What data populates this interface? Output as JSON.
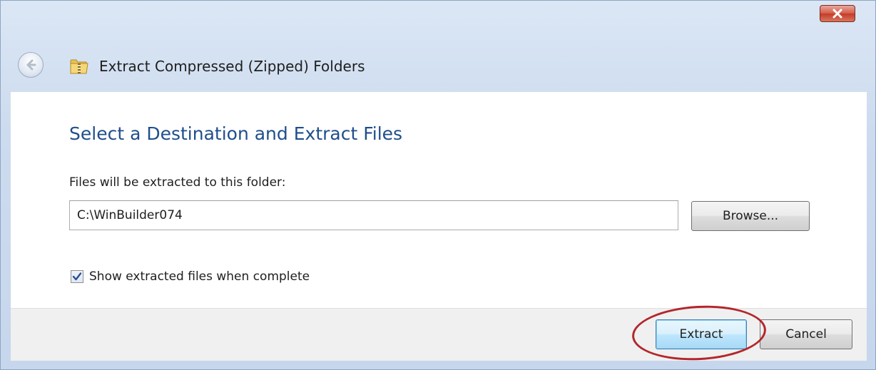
{
  "window": {
    "title": "Extract Compressed (Zipped) Folders",
    "close_icon": "close-icon",
    "back_icon": "back-arrow-icon",
    "app_icon": "zip-folder-icon"
  },
  "page": {
    "heading": "Select a Destination and Extract Files",
    "folder_label": "Files will be extracted to this folder:",
    "folder_path": "C:\\WinBuilder074",
    "browse_label": "Browse...",
    "show_files_label": "Show extracted files when complete",
    "show_files_checked": true
  },
  "footer": {
    "extract_label": "Extract",
    "cancel_label": "Cancel"
  },
  "colors": {
    "heading": "#1f4e8c",
    "highlight": "#b3262b",
    "close_button": "#c33b27"
  }
}
